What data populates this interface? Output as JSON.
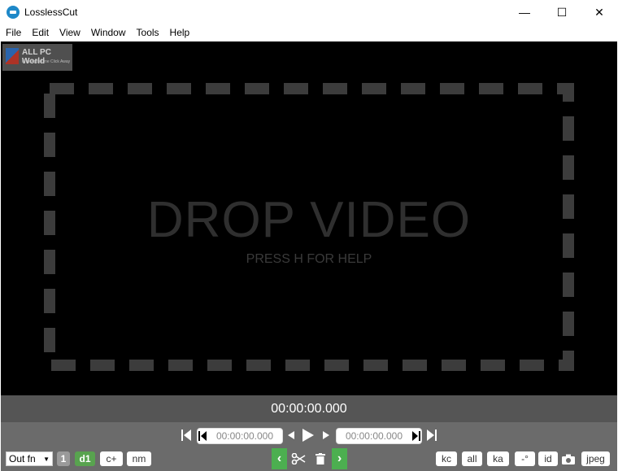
{
  "window": {
    "title": "LosslessCut",
    "minimize_glyph": "—",
    "maximize_glyph": "☐",
    "close_glyph": "✕"
  },
  "menu": [
    {
      "label": "File"
    },
    {
      "label": "Edit"
    },
    {
      "label": "View"
    },
    {
      "label": "Window"
    },
    {
      "label": "Tools"
    },
    {
      "label": "Help"
    }
  ],
  "watermark": {
    "title": "ALL PC World",
    "subtitle": "Free Apps One Click Away"
  },
  "player": {
    "drop_title": "DROP VIDEO",
    "drop_hint": "PRESS H FOR HELP"
  },
  "current_time": "00:00:00.000",
  "cut": {
    "start_time": "00:00:00.000",
    "end_time": "00:00:00.000"
  },
  "bottom_left": {
    "output_format": "Out fn",
    "segment_number": "1",
    "d1_label": "d1",
    "cplus_label": "c+",
    "nm_label": "nm"
  },
  "bottom_right": {
    "kc_label": "kc",
    "all_label": "all",
    "ka_label": "ka",
    "rotation_label": "-°",
    "id_label": "id",
    "capture_format": "jpeg"
  },
  "icons": {
    "jump_start": "jump-to-start-icon",
    "set_start": "set-cut-start-icon",
    "prev_frame": "previous-frame-icon",
    "play": "play-icon",
    "next_frame": "next-frame-icon",
    "set_end": "set-cut-end-icon",
    "jump_end": "jump-to-end-icon",
    "cut_start": "chevron-left-icon",
    "scissors": "scissors-icon",
    "trash": "trash-icon",
    "cut_end": "chevron-right-icon",
    "camera": "camera-icon"
  },
  "colors": {
    "accent_green": "#4caf50",
    "player_bg": "#000000",
    "timebar_bg": "#555555",
    "controls_bg": "#6b6b6b"
  }
}
